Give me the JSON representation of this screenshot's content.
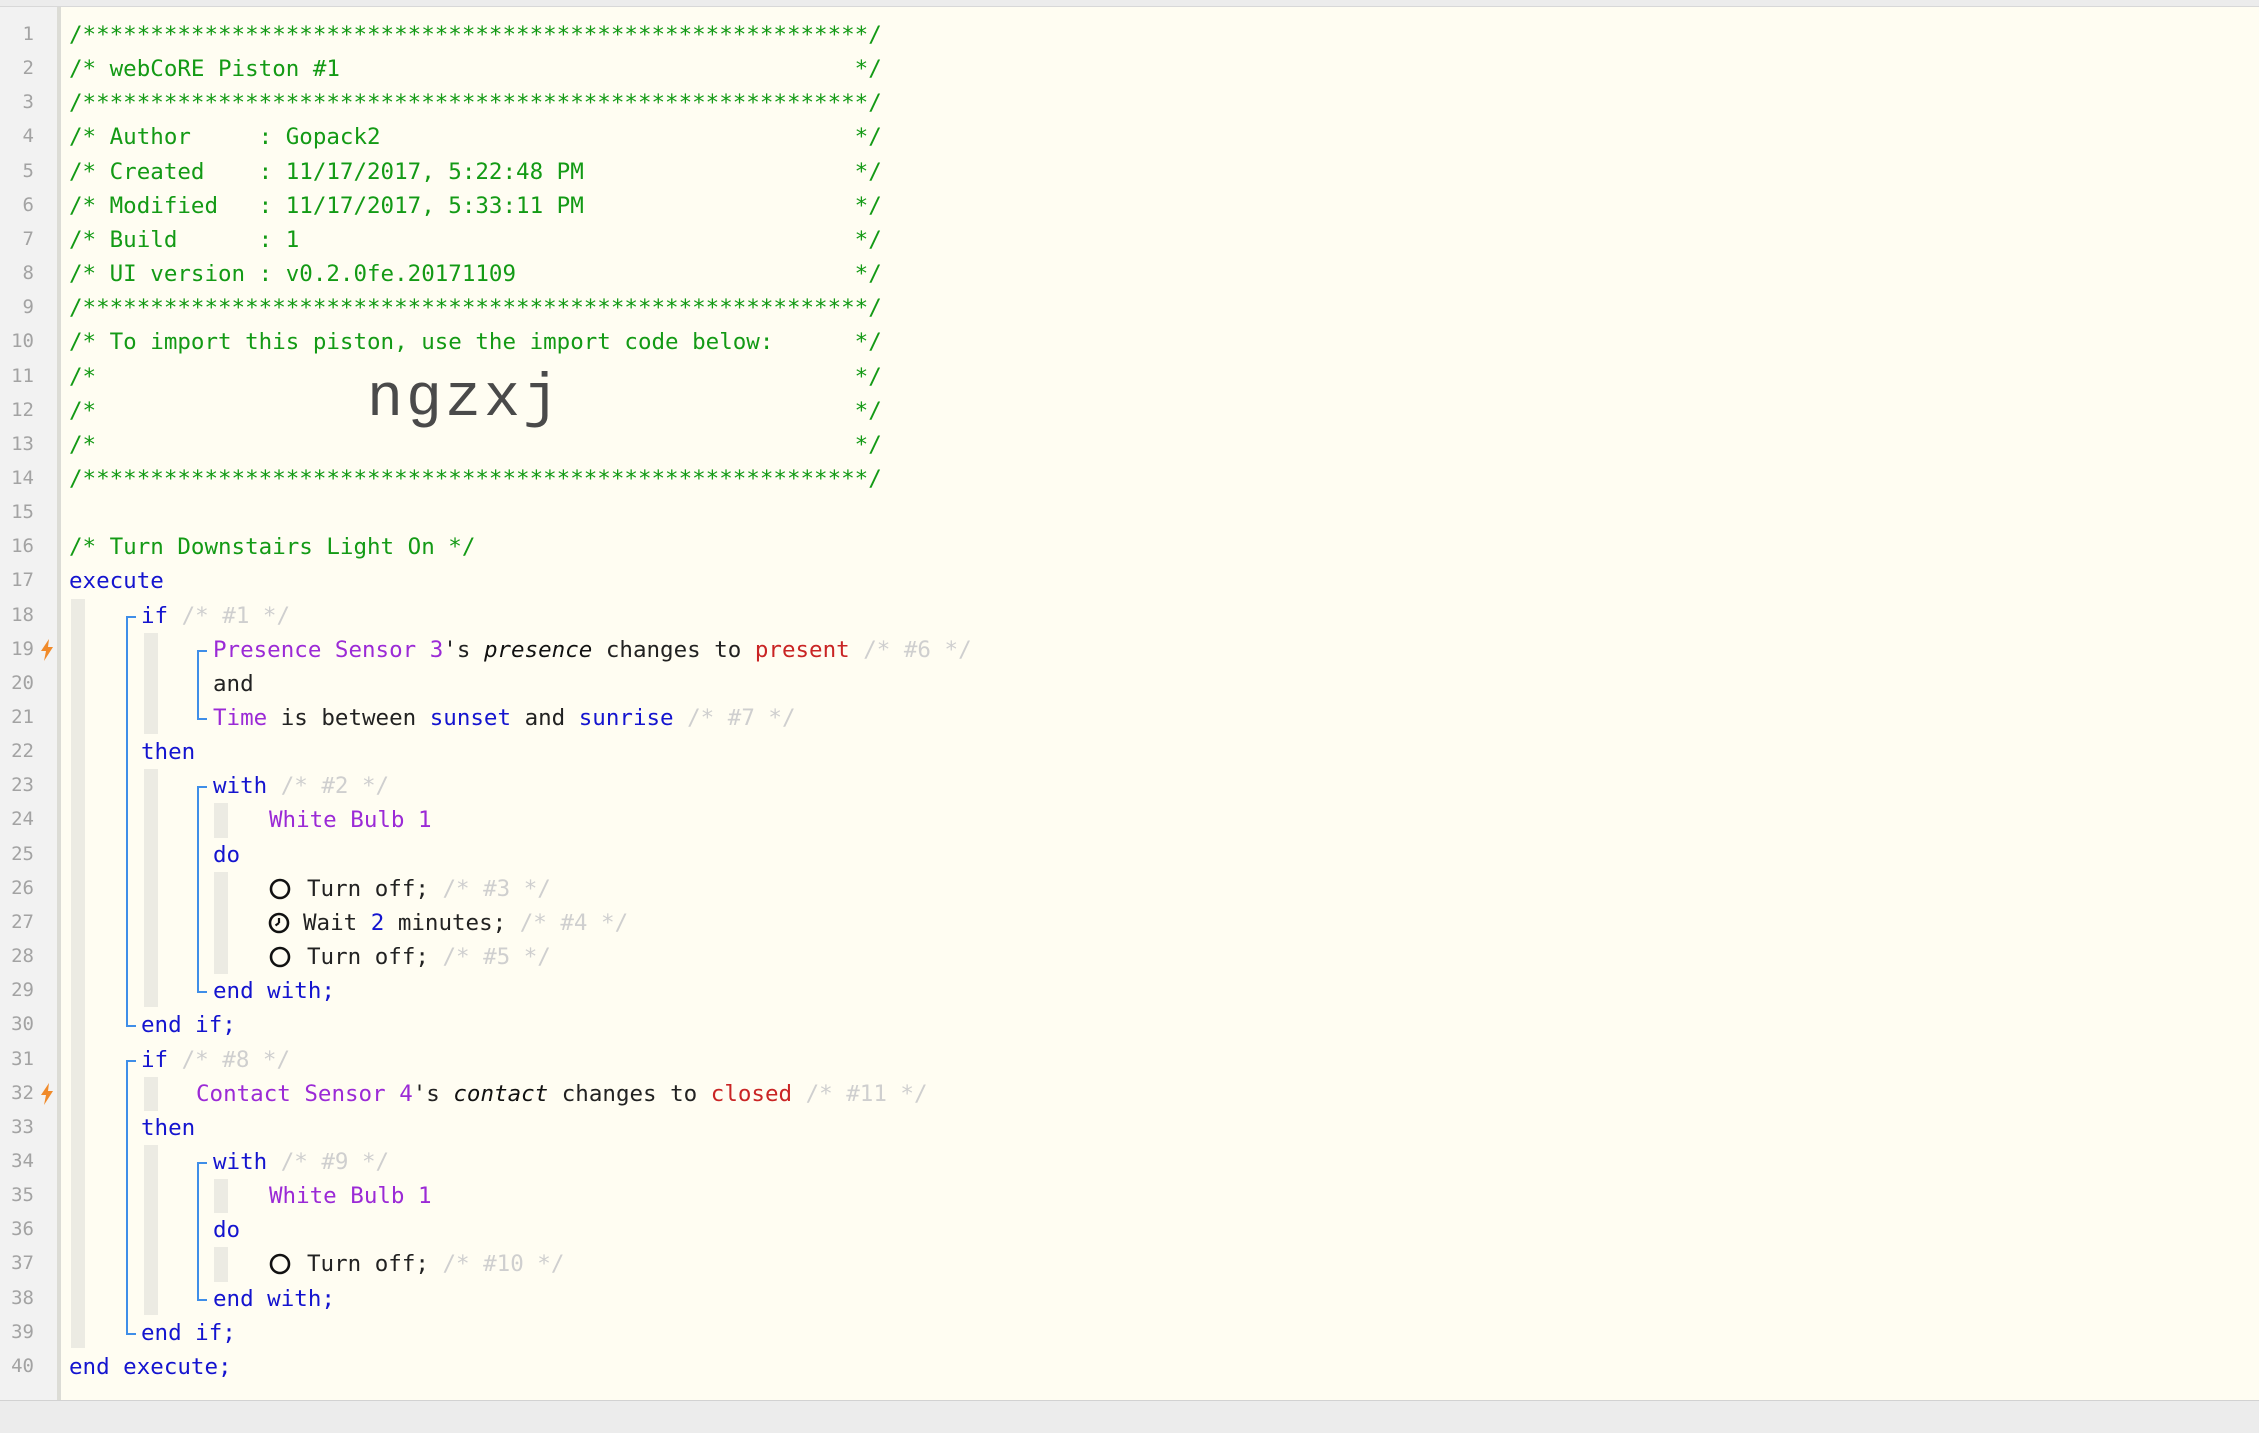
{
  "code": {
    "header": [
      "/**********************************************************/",
      "/* webCoRE Piston #1                                      */",
      "/**********************************************************/",
      "/* Author     : Gopack2                                   */",
      "/* Created    : 11/17/2017, 5:22:48 PM                    */",
      "/* Modified   : 11/17/2017, 5:33:11 PM                    */",
      "/* Build      : 1                                         */",
      "/* UI version : v0.2.0fe.20171109                         */",
      "/**********************************************************/",
      "/* To import this piston, use the import code below:      */",
      "/*                                                        */",
      "/*                                                        */",
      "/*                                                        */",
      "/**********************************************************/"
    ],
    "import_code": "ngzxj",
    "description": "/* Turn Downstairs Light On */",
    "kw": {
      "execute": "execute",
      "if": "if",
      "then": "then",
      "with": "with",
      "do": "do",
      "and": "and",
      "end_with": "end with;",
      "end_if": "end if;",
      "end_execute": "end execute;"
    },
    "ids": {
      "c1": "/* #1 */",
      "c2": "/* #2 */",
      "c3": "/* #3 */",
      "c4": "/* #4 */",
      "c5": "/* #5 */",
      "c6": "/* #6 */",
      "c7": "/* #7 */",
      "c8": "/* #8 */",
      "c9": "/* #9 */",
      "c10": "/* #10 */",
      "c11": "/* #11 */"
    },
    "cond1": {
      "device": "Presence Sensor 3",
      "poss": "'s ",
      "attr": "presence",
      "op": " changes to ",
      "value": "present"
    },
    "cond2": {
      "device": "Time",
      "op": " is between ",
      "v1": "sunset",
      "and": " and ",
      "v2": "sunrise"
    },
    "cond3": {
      "device": "Contact Sensor 4",
      "poss": "'s ",
      "attr": "contact",
      "op": " changes to ",
      "value": "closed"
    },
    "device_bulb": "White Bulb 1",
    "actions": {
      "turn_off": "Turn off;",
      "wait_pre": "Wait ",
      "wait_num": "2",
      "wait_post": " minutes;"
    }
  }
}
